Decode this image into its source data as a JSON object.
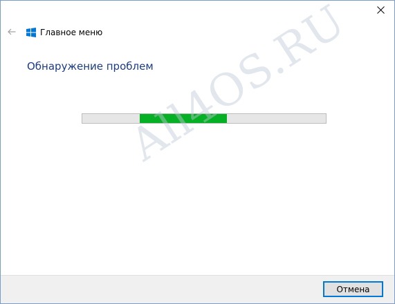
{
  "window": {
    "close_icon": "close-icon"
  },
  "nav": {
    "back_icon": "back-arrow-icon",
    "app_icon": "windows-logo-icon",
    "title": "Главное меню"
  },
  "main": {
    "heading": "Обнаружение проблем",
    "progress": {
      "type": "indeterminate",
      "fill_start_fraction": 0.235,
      "fill_end_fraction": 0.595,
      "color": "#06b025"
    },
    "watermark": "All4OS.RU"
  },
  "footer": {
    "cancel_label": "Отмена"
  },
  "colors": {
    "heading": "#1a3a8a",
    "accent": "#0078d7",
    "progress_fill": "#06b025",
    "windows_logo": "#0078d7"
  }
}
